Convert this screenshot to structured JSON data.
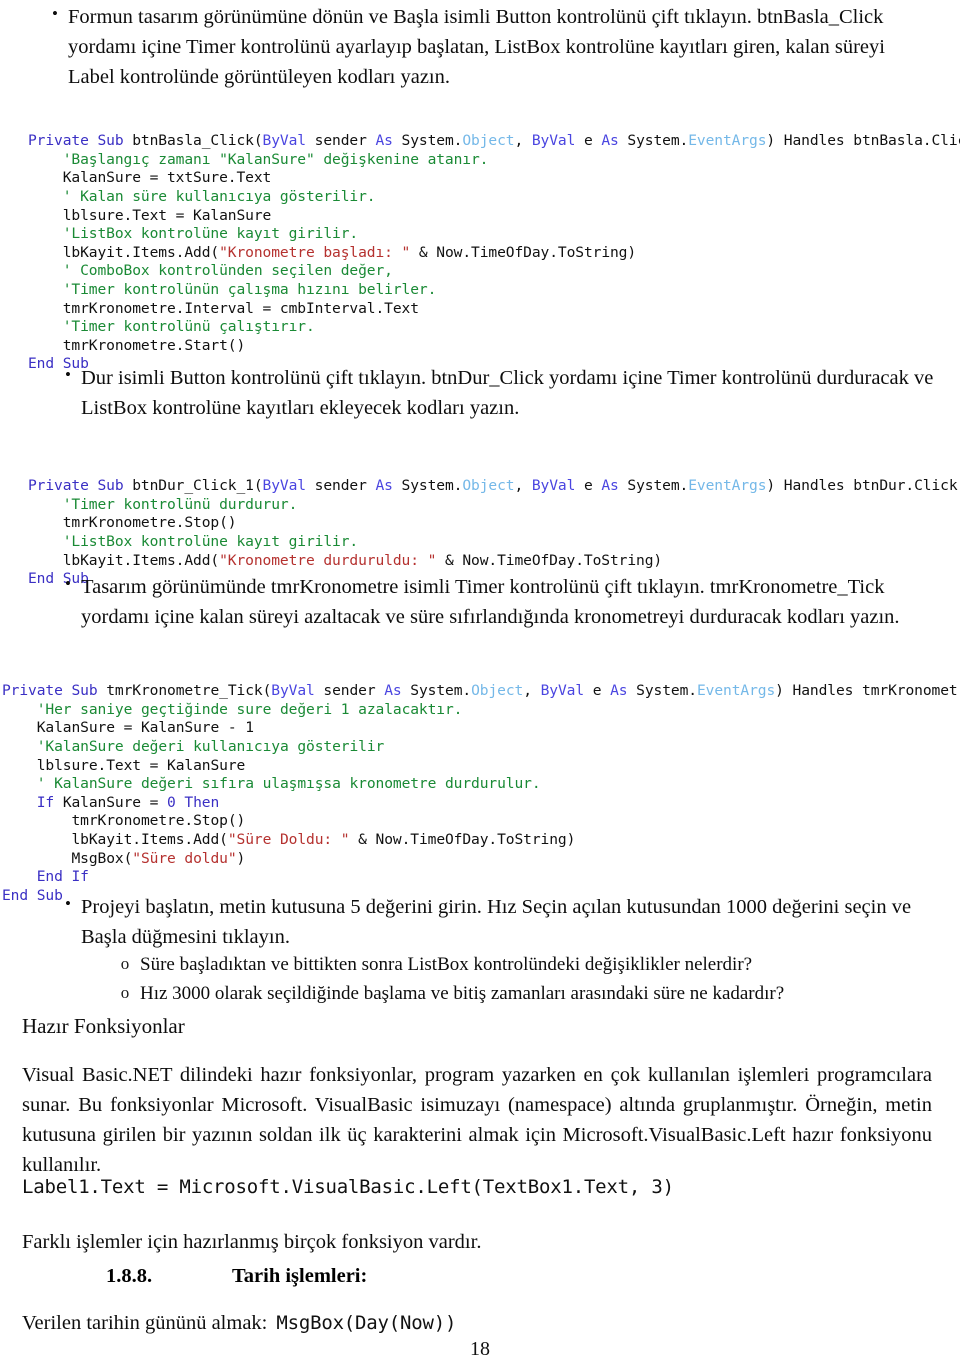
{
  "document": {
    "language": "tr",
    "page_number": "18"
  },
  "bullets": {
    "b1": "Formun tasarım görünümüne dönün ve Başla isimli Button kontrolünü çift tıklayın. btnBasla_Click yordamı içine Timer kontrolünü ayarlayıp başlatan, ListBox kontrolüne kayıtları giren, kalan süreyi Label kontrolünde görüntüleyen kodları yazın.",
    "b2": "Dur isimli Button kontrolünü çift tıklayın. btnDur_Click yordamı içine Timer kontrolünü durduracak ve ListBox kontrolüne kayıtları ekleyecek kodları yazın.",
    "b3": "Tasarım görünümünde tmrKronometre isimli Timer kontrolünü çift tıklayın. tmrKronometre_Tick yordamı içine kalan süreyi azaltacak ve süre sıfırlandığında kronometreyi durduracak kodları yazın.",
    "b4": "Projeyi başlatın, metin kutusuna 5 değerini girin. Hız Seçin açılan kutusundan 1000 değerini seçin ve Başla düğmesini tıklayın.",
    "marker": "•",
    "sub_marker": "o",
    "sub1": "Süre başladıktan ve bittikten sonra ListBox kontrolündeki değişiklikler nelerdir?",
    "sub2": "Hız 3000 olarak seçildiğinde başlama ve bitiş zamanları arasındaki süre ne kadardır?"
  },
  "code_blocks": {
    "basla": {
      "lines": [
        [
          {
            "t": "Private Sub ",
            "c": "kw"
          },
          {
            "t": "btnBasla_Click(",
            "c": ""
          },
          {
            "t": "ByVal ",
            "c": "kw2"
          },
          {
            "t": "sender ",
            "c": ""
          },
          {
            "t": "As ",
            "c": "kw2"
          },
          {
            "t": "System.",
            "c": ""
          },
          {
            "t": "Object",
            "c": "type"
          },
          {
            "t": ", ",
            "c": ""
          },
          {
            "t": "ByVal ",
            "c": "kw2"
          },
          {
            "t": "e ",
            "c": ""
          },
          {
            "t": "As ",
            "c": "kw2"
          },
          {
            "t": "System.",
            "c": ""
          },
          {
            "t": "EventArgs",
            "c": "type"
          },
          {
            "t": ") Handles btnBasla.Click",
            "c": ""
          }
        ],
        [
          {
            "t": "    'Başlangıç zamanı \"KalanSure\" değişkenine atanır.",
            "c": "cmt"
          }
        ],
        [
          {
            "t": "    KalanSure = txtSure.Text",
            "c": ""
          }
        ],
        [
          {
            "t": "    ' Kalan süre kullanıcıya gösterilir.",
            "c": "cmt"
          }
        ],
        [
          {
            "t": "    lblsure.Text = KalanSure",
            "c": ""
          }
        ],
        [
          {
            "t": "    'ListBox kontrolüne kayıt girilir.",
            "c": "cmt"
          }
        ],
        [
          {
            "t": "    lbKayit.Items.Add(",
            "c": ""
          },
          {
            "t": "\"Kronometre başladı: \"",
            "c": "str"
          },
          {
            "t": " & Now.TimeOfDay.ToString)",
            "c": ""
          }
        ],
        [
          {
            "t": "    ' ComboBox kontrolünden seçilen değer,",
            "c": "cmt"
          }
        ],
        [
          {
            "t": "    'Timer kontrolünün çalışma hızını belirler.",
            "c": "cmt"
          }
        ],
        [
          {
            "t": "    tmrKronometre.Interval = cmbInterval.Text",
            "c": ""
          }
        ],
        [
          {
            "t": "    'Timer kontrolünü çalıştırır.",
            "c": "cmt"
          }
        ],
        [
          {
            "t": "    tmrKronometre.Start()",
            "c": ""
          }
        ],
        [
          {
            "t": "End Sub",
            "c": "kw"
          }
        ]
      ]
    },
    "dur": {
      "lines": [
        [
          {
            "t": "Private Sub ",
            "c": "kw"
          },
          {
            "t": "btnDur_Click_1(",
            "c": ""
          },
          {
            "t": "ByVal ",
            "c": "kw2"
          },
          {
            "t": "sender ",
            "c": ""
          },
          {
            "t": "As ",
            "c": "kw2"
          },
          {
            "t": "System.",
            "c": ""
          },
          {
            "t": "Object",
            "c": "type"
          },
          {
            "t": ", ",
            "c": ""
          },
          {
            "t": "ByVal ",
            "c": "kw2"
          },
          {
            "t": "e ",
            "c": ""
          },
          {
            "t": "As ",
            "c": "kw2"
          },
          {
            "t": "System.",
            "c": ""
          },
          {
            "t": "EventArgs",
            "c": "type"
          },
          {
            "t": ") Handles btnDur.Click",
            "c": ""
          }
        ],
        [
          {
            "t": "    'Timer kontrolünü durdurur.",
            "c": "cmt"
          }
        ],
        [
          {
            "t": "    tmrKronometre.Stop()",
            "c": ""
          }
        ],
        [
          {
            "t": "    'ListBox kontrolüne kayıt girilir.",
            "c": "cmt"
          }
        ],
        [
          {
            "t": "    lbKayit.Items.Add(",
            "c": ""
          },
          {
            "t": "\"Kronometre durduruldu: \"",
            "c": "str"
          },
          {
            "t": " & Now.TimeOfDay.ToString)",
            "c": ""
          }
        ],
        [
          {
            "t": "End Sub",
            "c": "kw"
          }
        ]
      ]
    },
    "tick": {
      "lines": [
        [
          {
            "t": "Private Sub ",
            "c": "kw"
          },
          {
            "t": "tmrKronometre_Tick(",
            "c": ""
          },
          {
            "t": "ByVal ",
            "c": "kw2"
          },
          {
            "t": "sender ",
            "c": ""
          },
          {
            "t": "As ",
            "c": "kw2"
          },
          {
            "t": "System.",
            "c": ""
          },
          {
            "t": "Object",
            "c": "type"
          },
          {
            "t": ", ",
            "c": ""
          },
          {
            "t": "ByVal ",
            "c": "kw2"
          },
          {
            "t": "e ",
            "c": ""
          },
          {
            "t": "As ",
            "c": "kw2"
          },
          {
            "t": "System.",
            "c": ""
          },
          {
            "t": "EventArgs",
            "c": "type"
          },
          {
            "t": ") Handles tmrKronometre.Tick",
            "c": ""
          }
        ],
        [
          {
            "t": "    'Her saniye geçtiğinde sure değeri 1 azalacaktır.",
            "c": "cmt"
          }
        ],
        [
          {
            "t": "    KalanSure = KalanSure - 1",
            "c": ""
          }
        ],
        [
          {
            "t": "    'KalanSure değeri kullanıcıya gösterilir",
            "c": "cmt"
          }
        ],
        [
          {
            "t": "    lblsure.Text = KalanSure",
            "c": ""
          }
        ],
        [
          {
            "t": "    ' KalanSure değeri sıfıra ulaşmışsa kronometre durdurulur.",
            "c": "cmt"
          }
        ],
        [
          {
            "t": "    If ",
            "c": "kw"
          },
          {
            "t": "KalanSure = ",
            "c": ""
          },
          {
            "t": "0",
            "c": "num"
          },
          {
            "t": " Then",
            "c": "kw"
          }
        ],
        [
          {
            "t": "        tmrKronometre.Stop()",
            "c": ""
          }
        ],
        [
          {
            "t": "        lbKayit.Items.Add(",
            "c": ""
          },
          {
            "t": "\"Süre Doldu: \"",
            "c": "str"
          },
          {
            "t": " & Now.TimeOfDay.ToString)",
            "c": ""
          }
        ],
        [
          {
            "t": "        MsgBox(",
            "c": ""
          },
          {
            "t": "\"Süre doldu\"",
            "c": "str"
          },
          {
            "t": ")",
            "c": ""
          }
        ],
        [
          {
            "t": "    End If",
            "c": "kw"
          }
        ],
        [
          {
            "t": "End Sub",
            "c": "kw"
          }
        ]
      ]
    }
  },
  "sections": {
    "hazir_fonksiyonlar_title": "Hazır Fonksiyonlar",
    "paragraph_1": "Visual Basic.NET dilindeki hazır fonksiyonlar, program yazarken en çok kullanılan işlemleri programcılara sunar. Bu fonksiyonlar Microsoft. VisualBasic isimuzayı (namespace) altında gruplanmıştır. Örneğin, metin kutusuna girilen bir yazının soldan ilk üç karakterini almak için Microsoft.VisualBasic.Left hazır fonksiyonu kullanılır.",
    "code_example_left": "Label1.Text = Microsoft.VisualBasic.Left(TextBox1.Text, 3)",
    "paragraph_2": "Farklı işlemler için hazırlanmış birçok fonksiyon vardır.",
    "heading_number": "1.8.8.",
    "heading_title": "Tarih işlemleri:",
    "last_line_prefix": "Verilen tarihin gününü almak:",
    "last_line_code": "MsgBox(Day(Now))"
  },
  "colors": {
    "keyword": "#3a2fc4",
    "keyword_alt": "#4a45e0",
    "type": "#74b8e8",
    "comment": "#1a8a35",
    "string": "#b5312f",
    "text": "#111111",
    "background": "#ffffff"
  }
}
